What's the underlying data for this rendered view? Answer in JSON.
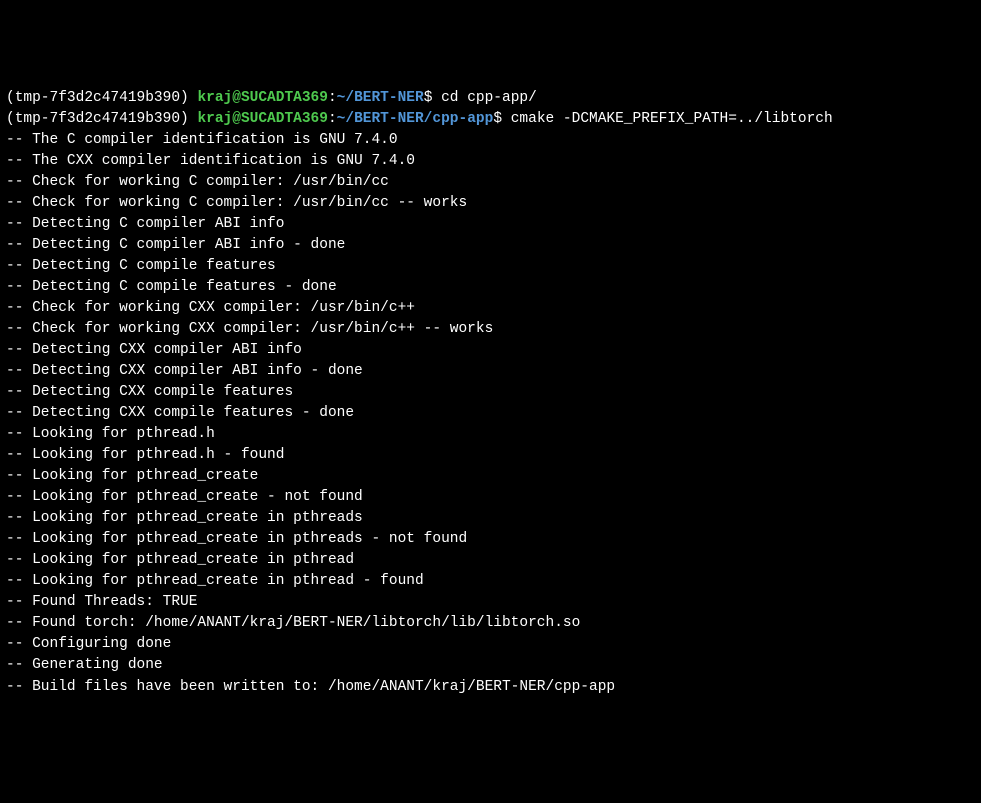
{
  "prompt1": {
    "venv": "(tmp-7f3d2c47419b390) ",
    "userhost": "kraj@SUCADTA369",
    "colon": ":",
    "path": "~/BERT-NER",
    "dollar": "$ ",
    "cmd": "cd cpp-app/"
  },
  "prompt2": {
    "venv": "(tmp-7f3d2c47419b390) ",
    "userhost": "kraj@SUCADTA369",
    "colon": ":",
    "path": "~/BERT-NER/cpp-app",
    "dollar": "$ ",
    "cmd": "cmake -DCMAKE_PREFIX_PATH=../libtorch"
  },
  "out": [
    "-- The C compiler identification is GNU 7.4.0",
    "-- The CXX compiler identification is GNU 7.4.0",
    "-- Check for working C compiler: /usr/bin/cc",
    "-- Check for working C compiler: /usr/bin/cc -- works",
    "-- Detecting C compiler ABI info",
    "-- Detecting C compiler ABI info - done",
    "-- Detecting C compile features",
    "-- Detecting C compile features - done",
    "-- Check for working CXX compiler: /usr/bin/c++",
    "-- Check for working CXX compiler: /usr/bin/c++ -- works",
    "-- Detecting CXX compiler ABI info",
    "-- Detecting CXX compiler ABI info - done",
    "-- Detecting CXX compile features",
    "-- Detecting CXX compile features - done",
    "-- Looking for pthread.h",
    "-- Looking for pthread.h - found",
    "-- Looking for pthread_create",
    "-- Looking for pthread_create - not found",
    "-- Looking for pthread_create in pthreads",
    "-- Looking for pthread_create in pthreads - not found",
    "-- Looking for pthread_create in pthread",
    "-- Looking for pthread_create in pthread - found",
    "-- Found Threads: TRUE",
    "-- Found torch: /home/ANANT/kraj/BERT-NER/libtorch/lib/libtorch.so",
    "-- Configuring done",
    "-- Generating done",
    "-- Build files have been written to: /home/ANANT/kraj/BERT-NER/cpp-app"
  ]
}
